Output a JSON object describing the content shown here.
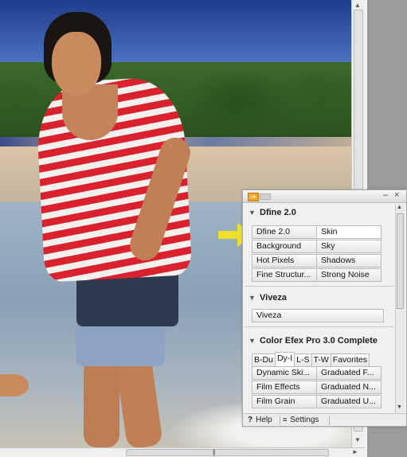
{
  "palette": {
    "sections": {
      "dfine": {
        "title": "Dfine 2.0",
        "buttons": [
          "Dfine 2.0",
          "Skin",
          "Background",
          "Sky",
          "Hot Pixels",
          "Shadows",
          "Fine Structur...",
          "Strong Noise"
        ]
      },
      "viveza": {
        "title": "Viveza",
        "buttons": [
          "Viveza"
        ]
      },
      "cep": {
        "title": "Color Efex Pro 3.0 Complete",
        "tabs": [
          "B-Du",
          "Dy-I",
          "L-S",
          "T-W",
          "Favorites"
        ],
        "buttons": [
          "Dynamic Ski...",
          "Graduated F...",
          "Film Effects",
          "Graduated N...",
          "Film Grain",
          "Graduated U..."
        ]
      }
    },
    "footer": {
      "help_icon": "?",
      "help_label": "Help",
      "settings_icon": "≡",
      "settings_label": "Settings"
    },
    "logo_text": "nik"
  },
  "colors": {
    "annotation_arrow": "#f5e61b",
    "palette_bg": "#f0f0f0"
  }
}
